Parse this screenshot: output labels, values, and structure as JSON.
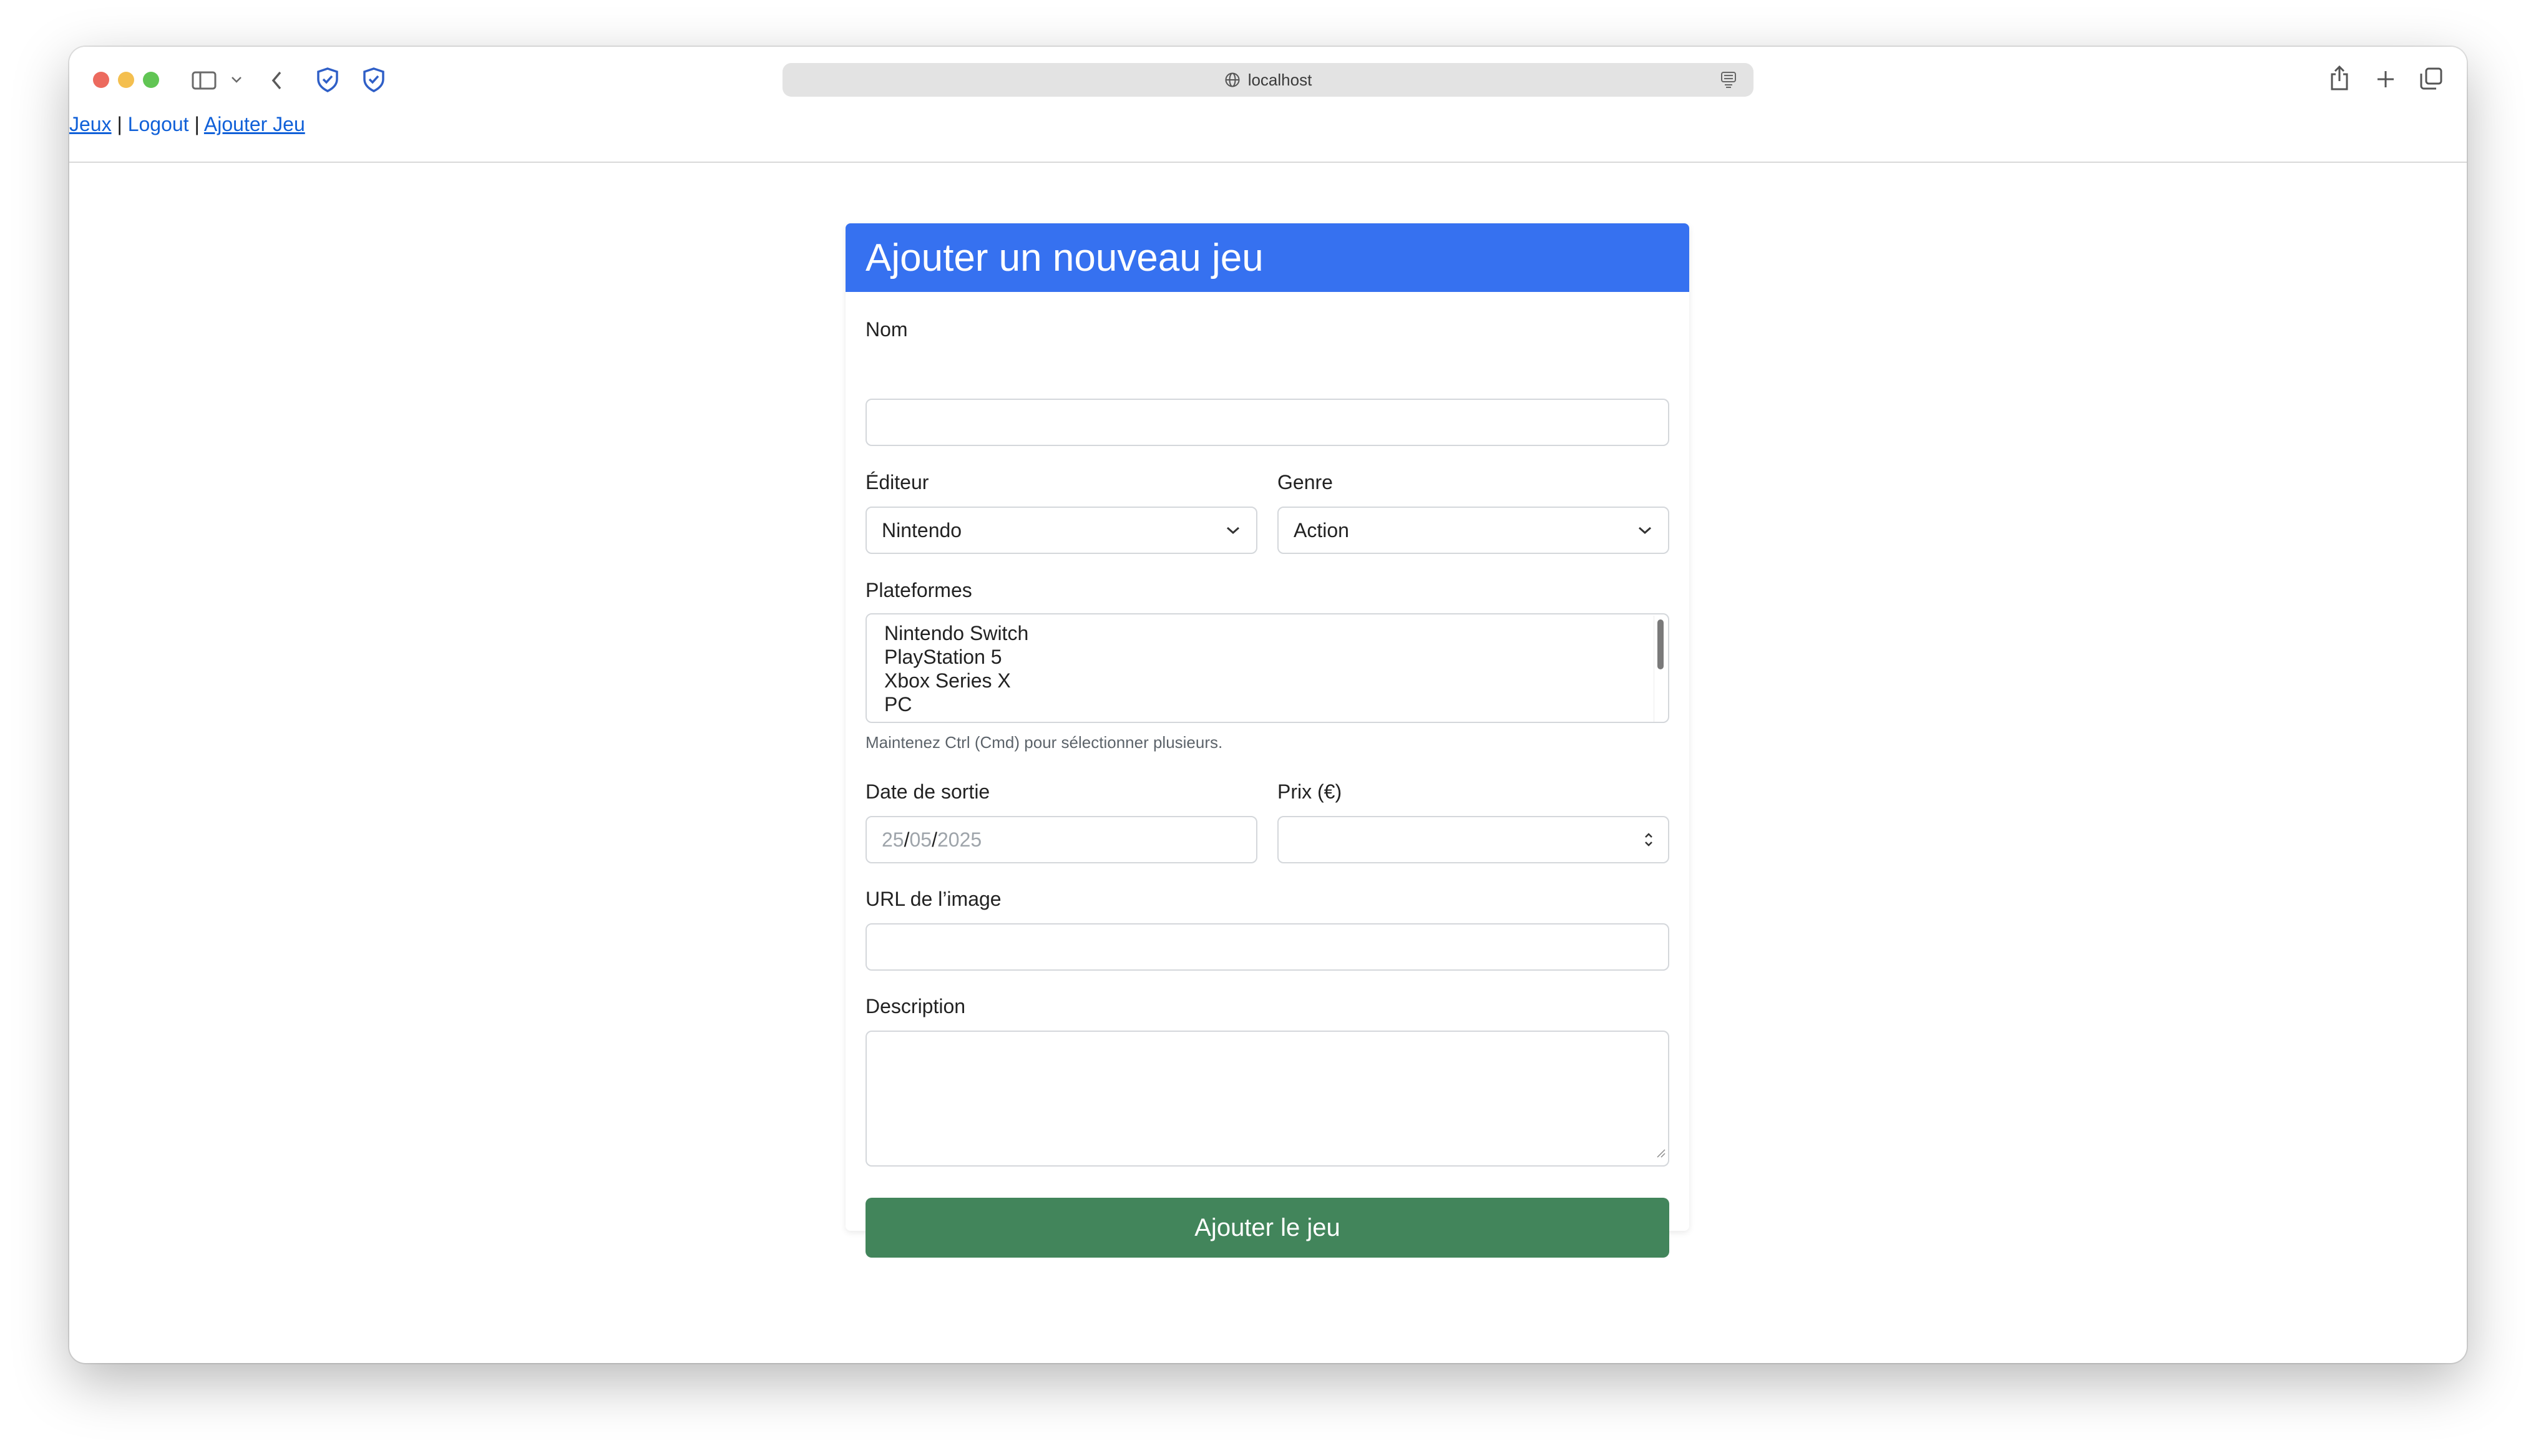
{
  "browser": {
    "url": "localhost",
    "traffic_colors": {
      "close": "#ec6a5e",
      "minimize": "#f4bf4f",
      "maximize": "#61c554"
    }
  },
  "nav": {
    "jeux": "Jeux",
    "sep1": "|",
    "logout": "Logout",
    "sep2": "|",
    "ajouter_jeu": "Ajouter Jeu"
  },
  "form": {
    "title": "Ajouter un nouveau jeu",
    "header_color": "#3671f0",
    "nom": {
      "label": "Nom",
      "value": ""
    },
    "editeur": {
      "label": "Éditeur",
      "value": "Nintendo"
    },
    "genre": {
      "label": "Genre",
      "value": "Action"
    },
    "plateformes": {
      "label": "Plateformes",
      "options": [
        "Nintendo Switch",
        "PlayStation 5",
        "Xbox Series X",
        "PC"
      ],
      "help": "Maintenez Ctrl (Cmd) pour sélectionner plusieurs."
    },
    "date_sortie": {
      "label": "Date de sortie",
      "day": "25",
      "month": "05",
      "year": "2025",
      "sep": "/"
    },
    "prix": {
      "label": "Prix (€)",
      "value": ""
    },
    "image_url": {
      "label": "URL de l’image",
      "value": ""
    },
    "description": {
      "label": "Description",
      "value": ""
    },
    "submit": {
      "label": "Ajouter le jeu",
      "color": "#42855b"
    }
  }
}
